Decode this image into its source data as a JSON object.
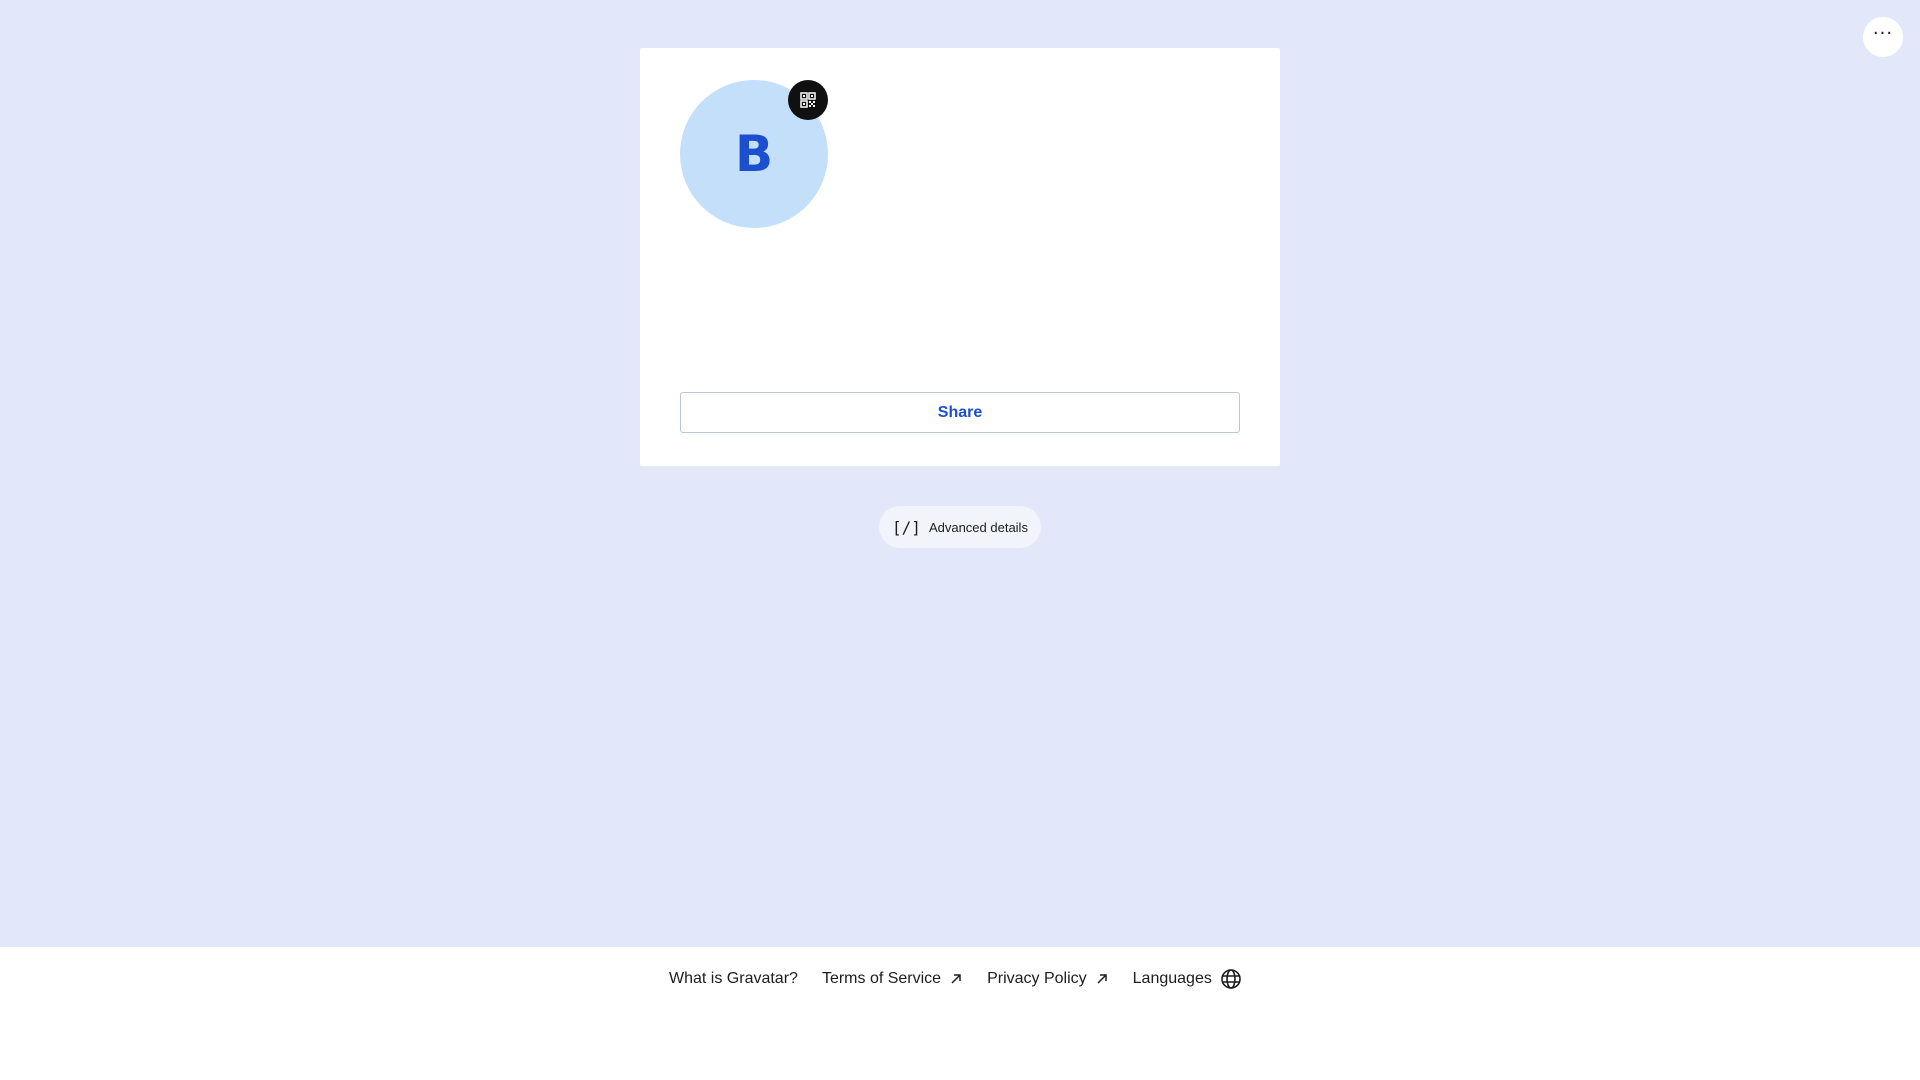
{
  "header": {
    "more_icon": "ellipsis-icon",
    "more_label": "···"
  },
  "profile": {
    "avatar_initial": "B",
    "avatar_bg": "#c4dffa",
    "avatar_fg": "#1c4fcf",
    "qr_icon": "qr-code-icon",
    "share_label": "Share"
  },
  "advanced": {
    "icon_text": "[/]",
    "label": "Advanced details"
  },
  "footer": {
    "links": [
      {
        "label": "What is Gravatar?",
        "icon": ""
      },
      {
        "label": "Terms of Service",
        "icon": "external-link-icon"
      },
      {
        "label": "Privacy Policy",
        "icon": "external-link-icon"
      },
      {
        "label": "Languages",
        "icon": "globe-icon"
      }
    ]
  },
  "colors": {
    "page_bg": "#e2e8f9",
    "accent": "#1c4fcf"
  }
}
